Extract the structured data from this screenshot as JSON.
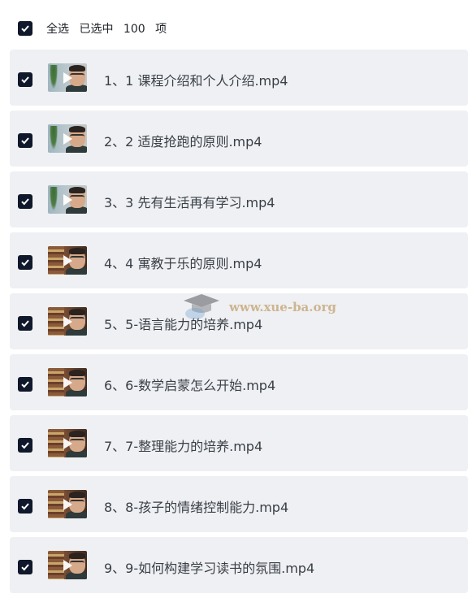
{
  "header": {
    "select_all_label": "全选",
    "selected_label": "已选中",
    "selected_count": "100",
    "unit_label": "项"
  },
  "items": [
    {
      "title": "1、1 课程介绍和个人介绍.mp4",
      "thumb": "style-a"
    },
    {
      "title": "2、2 适度抢跑的原则.mp4",
      "thumb": "style-a"
    },
    {
      "title": "3、3 先有生活再有学习.mp4",
      "thumb": "style-a"
    },
    {
      "title": "4、4 寓教于乐的原则.mp4",
      "thumb": "style-b"
    },
    {
      "title": "5、5-语言能力的培养.mp4",
      "thumb": "style-b"
    },
    {
      "title": "6、6-数学启蒙怎么开始.mp4",
      "thumb": "style-b"
    },
    {
      "title": "7、7-整理能力的培养.mp4",
      "thumb": "style-b"
    },
    {
      "title": "8、8-孩子的情绪控制能力.mp4",
      "thumb": "style-b"
    },
    {
      "title": "9、9-如何构建学习读书的氛围.mp4",
      "thumb": "style-b"
    }
  ],
  "watermark": {
    "text": "www.xue-ba.org"
  },
  "colors": {
    "checkbox": "#10182b",
    "row_bg": "#eef0f3"
  }
}
